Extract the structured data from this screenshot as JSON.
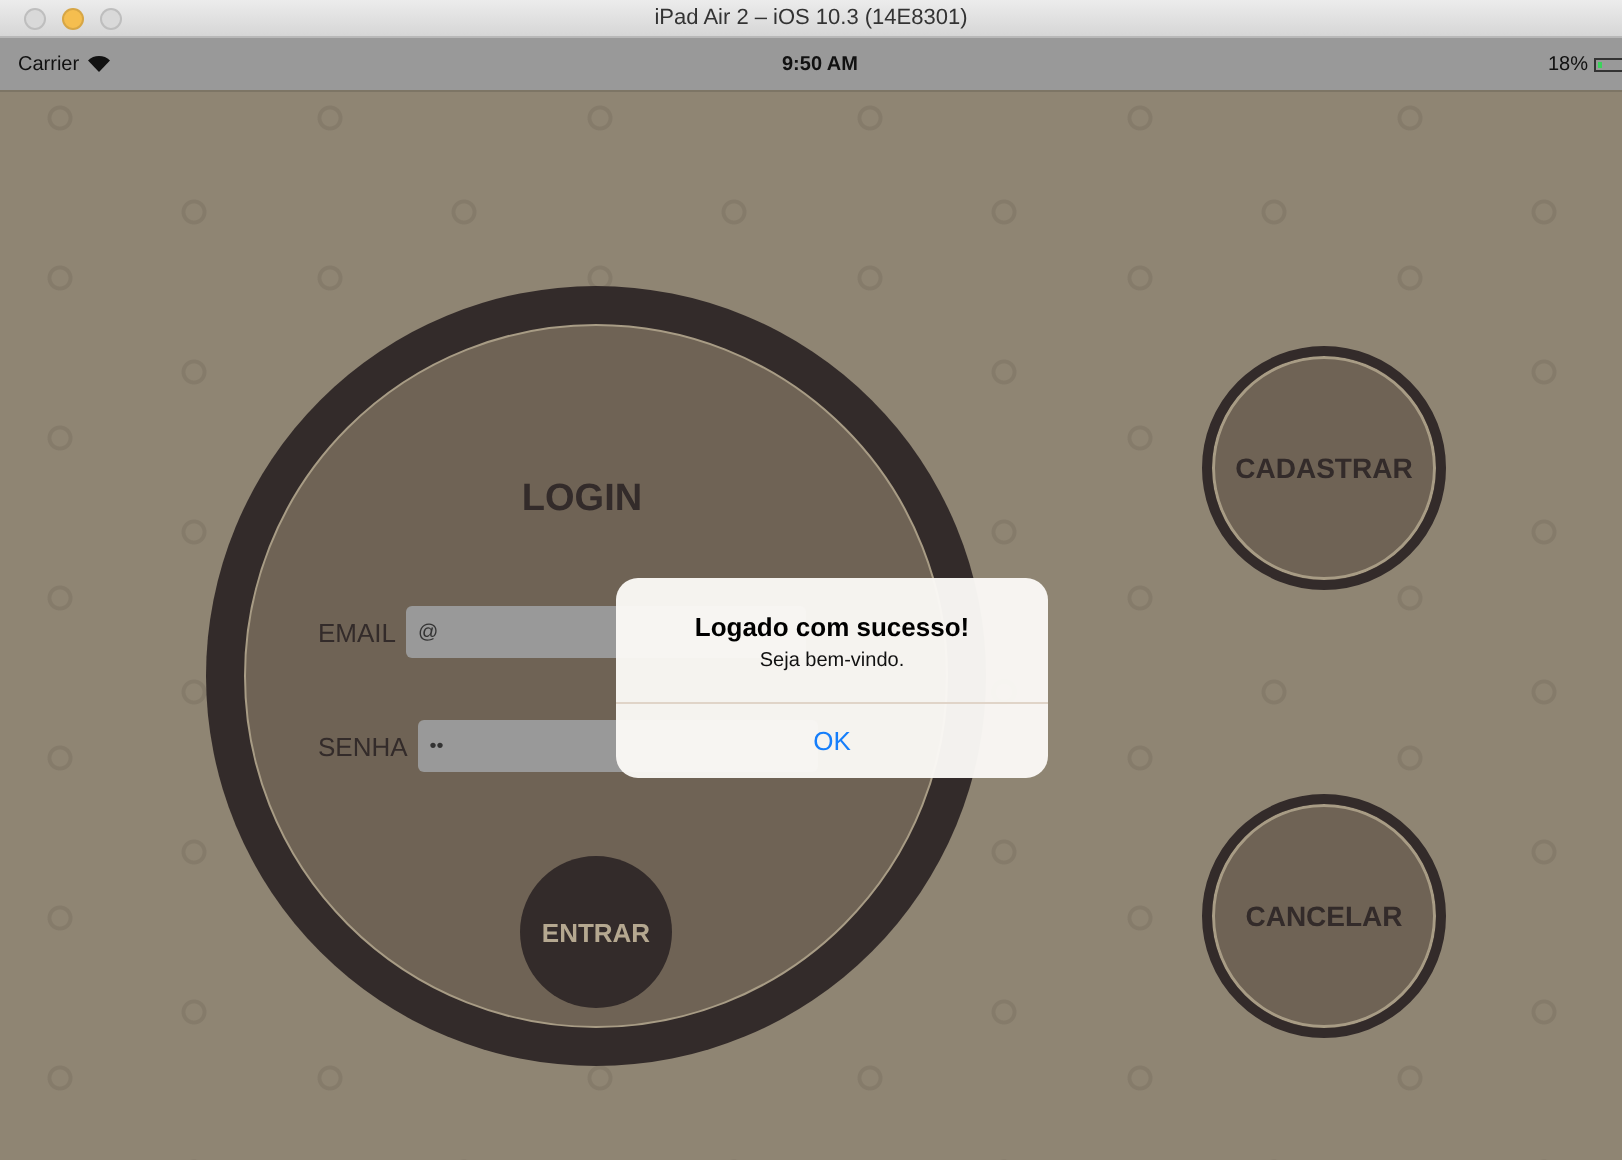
{
  "window": {
    "title": "iPad Air 2 – iOS 10.3 (14E8301)",
    "controls": [
      {
        "color": "#d9d9d9"
      },
      {
        "color": "#f5be4f"
      },
      {
        "color": "#d9d9d9"
      }
    ]
  },
  "status_bar": {
    "carrier": "Carrier",
    "time": "9:50 AM",
    "battery": "18%"
  },
  "login": {
    "title": "LOGIN",
    "fields": [
      {
        "label": "EMAIL",
        "value": "@"
      },
      {
        "label": "SENHA",
        "value": "••"
      }
    ],
    "submit": "ENTRAR"
  },
  "buttons": [
    "CADASTRAR",
    "CANCELAR"
  ],
  "alert": {
    "title": "Logado com sucesso!",
    "message": "Seja bem-vindo.",
    "action": "OK"
  }
}
